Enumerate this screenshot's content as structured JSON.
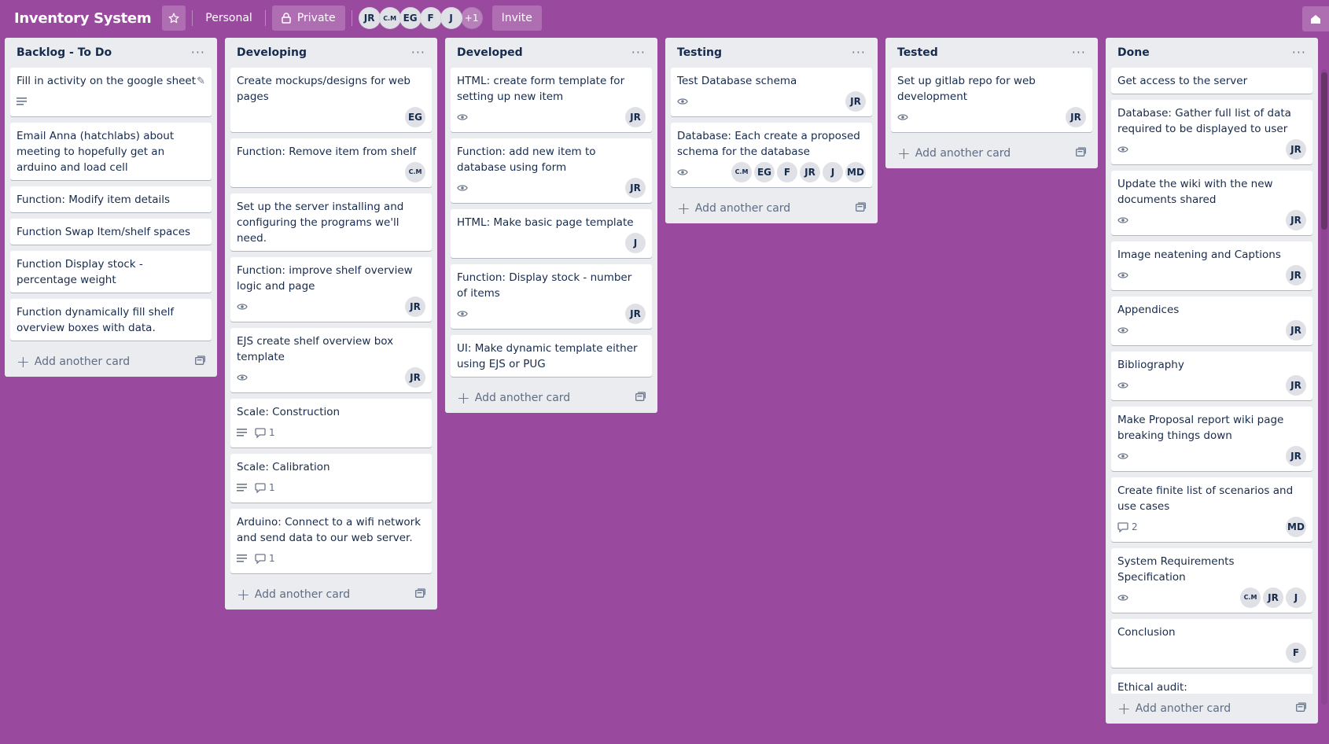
{
  "board": {
    "title": "Inventory System",
    "workspace": "Personal",
    "visibility": "Private",
    "members": [
      "JR",
      "C.M",
      "EG",
      "F",
      "J"
    ],
    "members_more": "+1",
    "invite_label": "Invite"
  },
  "lists": [
    {
      "title": "Backlog - To Do",
      "add_label": "Add another card",
      "cards": [
        {
          "title": "Fill in activity on the google sheet",
          "description": true
        },
        {
          "title": "Email Anna (hatchlabs) about meeting to hopefully get an arduino and load cell"
        },
        {
          "title": "Function: Modify item details"
        },
        {
          "title": "Function Swap Item/shelf spaces"
        },
        {
          "title": "Function Display stock - percentage weight"
        },
        {
          "title": "Function dynamically fill shelf overview boxes with data."
        }
      ]
    },
    {
      "title": "Developing",
      "add_label": "Add another card",
      "cards": [
        {
          "title": "Create mockups/designs for web pages",
          "members": [
            "EG"
          ]
        },
        {
          "title": "Function: Remove item from shelf",
          "members": [
            "C.M"
          ]
        },
        {
          "title": "Set up the server installing and configuring the programs we'll need."
        },
        {
          "title": "Function: improve shelf overview logic and page",
          "watch": true,
          "members": [
            "JR"
          ]
        },
        {
          "title": "EJS create shelf overview box template",
          "watch": true,
          "members": [
            "JR"
          ]
        },
        {
          "title": "Scale: Construction",
          "description": true,
          "comments": "1"
        },
        {
          "title": "Scale: Calibration",
          "description": true,
          "comments": "1"
        },
        {
          "title": "Arduino: Connect to a wifi network and send data to our web server.",
          "description": true,
          "comments": "1"
        }
      ]
    },
    {
      "title": "Developed",
      "add_label": "Add another card",
      "cards": [
        {
          "title": "HTML: create form template for setting up new item",
          "watch": true,
          "members": [
            "JR"
          ]
        },
        {
          "title": "Function: add new item to database using form",
          "watch": true,
          "members": [
            "JR"
          ]
        },
        {
          "title": "HTML: Make basic page template",
          "members": [
            "J"
          ]
        },
        {
          "title": "Function: Display stock - number of items",
          "watch": true,
          "members": [
            "JR"
          ]
        },
        {
          "title": "UI: Make dynamic template either using EJS or PUG"
        }
      ]
    },
    {
      "title": "Testing",
      "add_label": "Add another card",
      "cards": [
        {
          "title": "Test Database schema",
          "watch": true,
          "members": [
            "JR"
          ]
        },
        {
          "title": "Database: Each create a proposed schema for the database",
          "watch": true,
          "members": [
            "C.M",
            "EG",
            "F",
            "JR",
            "J",
            "MD"
          ]
        }
      ]
    },
    {
      "title": "Tested",
      "add_label": "Add another card",
      "cards": [
        {
          "title": "Set up gitlab repo for web development",
          "watch": true,
          "members": [
            "JR"
          ]
        }
      ]
    },
    {
      "title": "Done",
      "add_label": "Add another card",
      "cards": [
        {
          "title": "Get access to the server"
        },
        {
          "title": "Database: Gather full list of data required to be displayed to user",
          "watch": true,
          "members": [
            "JR"
          ]
        },
        {
          "title": "Update the wiki with the new documents shared",
          "watch": true,
          "members": [
            "JR"
          ]
        },
        {
          "title": "Image neatening and Captions",
          "watch": true,
          "members": [
            "JR"
          ]
        },
        {
          "title": "Appendices",
          "watch": true,
          "members": [
            "JR"
          ]
        },
        {
          "title": "Bibliography",
          "watch": true,
          "members": [
            "JR"
          ]
        },
        {
          "title": "Make Proposal report wiki page breaking things down",
          "watch": true,
          "members": [
            "JR"
          ]
        },
        {
          "title": "Create finite list of scenarios and use cases",
          "comments": "2",
          "members": [
            "MD"
          ]
        },
        {
          "title": "System Requirements Specification",
          "watch": true,
          "members": [
            "C.M",
            "JR",
            "J"
          ]
        },
        {
          "title": "Conclusion",
          "members": [
            "F"
          ]
        },
        {
          "title": "Ethical audit:"
        }
      ]
    }
  ],
  "colors": {
    "background": "#9a4a9e",
    "list_bg": "#ebecf0",
    "card_bg": "#ffffff"
  }
}
